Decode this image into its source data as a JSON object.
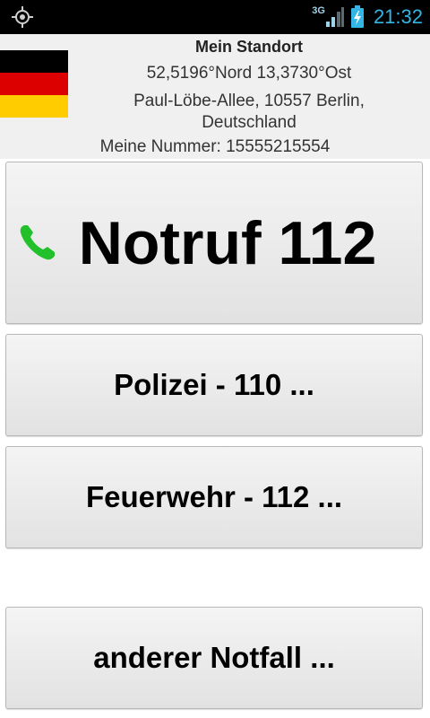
{
  "status_bar": {
    "network": "3G",
    "time": "21:32"
  },
  "header": {
    "title": "Mein Standort",
    "coordinates": "52,5196°Nord 13,3730°Ost",
    "address": "Paul-Löbe-Allee, 10557 Berlin, Deutschland",
    "my_number": "Meine Nummer: 15555215554",
    "flag_colors": [
      "#000000",
      "#dd0000",
      "#ffcc00"
    ]
  },
  "buttons": {
    "notruf": "Notruf 112",
    "polizei": "Polizei - 110 ...",
    "feuerwehr": "Feuerwehr - 112 ...",
    "andere": "anderer Notfall ..."
  },
  "icons": {
    "gps": "gps-icon",
    "signal": "signal-icon",
    "battery": "battery-charging-icon",
    "phone": "phone-icon"
  },
  "colors": {
    "phone_green": "#22c02a",
    "clock_blue": "#33b5e5"
  }
}
